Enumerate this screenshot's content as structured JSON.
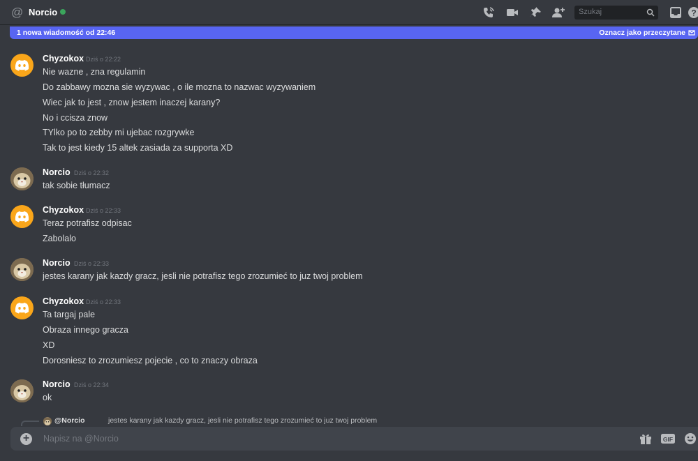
{
  "header": {
    "at_symbol": "@",
    "channel_name": "Norcio",
    "search_placeholder": "Szukaj"
  },
  "banner": {
    "new_messages": "1 nowa wiadomość od 22:46",
    "mark_read": "Oznacz jako przeczytane"
  },
  "messages": [
    {
      "author": "Chyzokox",
      "timestamp": "Dziś o 22:22",
      "lines": [
        "Nie wazne , zna regulamin",
        "Do zabbawy mozna sie wyzywac , o ile  mozna to nazwac wyzywaniem",
        "Wiec jak to jest , znow jestem inaczej karany?",
        "No i ccisza znow",
        "TYlko po to zebby mi  ujebac rozgrywke",
        "Tak to jest kiedy 15 altek zasiada za supporta XD"
      ]
    },
    {
      "author": "Norcio",
      "timestamp": "Dziś o 22:32",
      "lines": [
        "tak sobie tłumacz"
      ]
    },
    {
      "author": "Chyzokox",
      "timestamp": "Dziś o 22:33",
      "lines": [
        "Teraz potrafisz odpisac",
        "Zabolalo"
      ]
    },
    {
      "author": "Norcio",
      "timestamp": "Dziś o 22:33",
      "lines": [
        "jestes karany jak kazdy gracz, jesli nie potrafisz tego zrozumieć to juz twoj problem"
      ]
    },
    {
      "author": "Chyzokox",
      "timestamp": "Dziś o 22:33",
      "lines": [
        "Ta targaj pale",
        "Obraza innego gracza",
        "XD",
        "Dorosniesz to zrozumiesz pojecie , co to znaczy obraza"
      ]
    },
    {
      "author": "Norcio",
      "timestamp": "Dziś o 22:34",
      "lines": [
        "ok"
      ]
    }
  ],
  "reply": {
    "mention": "@Norcio",
    "text": "jestes karany jak kazdy gracz, jesli nie potrafisz tego zrozumieć to juz twoj problem"
  },
  "composer": {
    "placeholder": "Napisz na @Norcio",
    "plus": "+"
  },
  "colors": {
    "background": "#36393f",
    "accent": "#5865f2",
    "online": "#3ba55c",
    "discord_avatar": "#faa61a"
  }
}
